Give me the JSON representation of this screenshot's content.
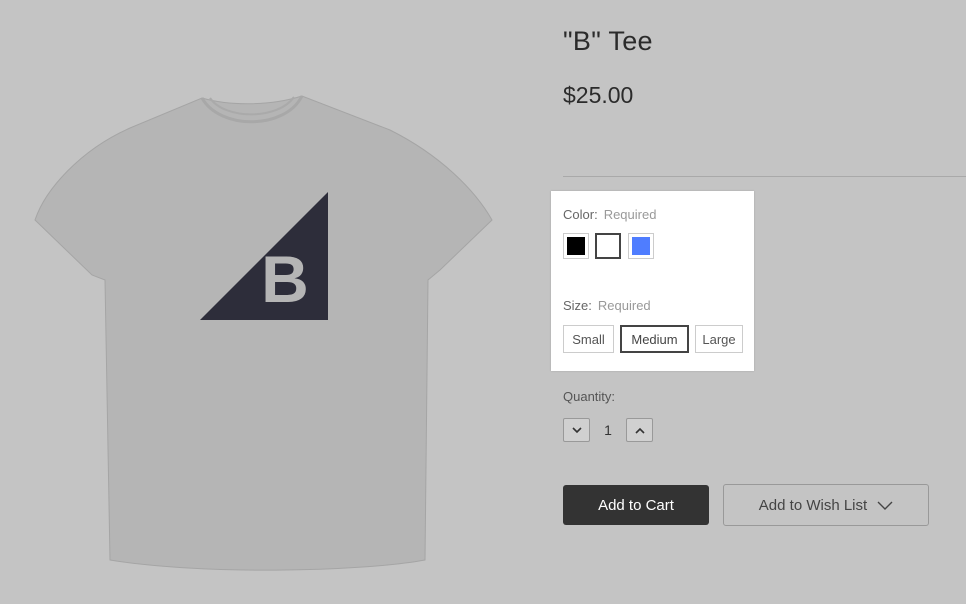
{
  "product": {
    "title": "\"B\" Tee",
    "price": "$25.00",
    "logo_letter": "B"
  },
  "options": {
    "color": {
      "label": "Color:",
      "required": "Required",
      "swatches": [
        {
          "name": "black",
          "hex": "#000000"
        },
        {
          "name": "white",
          "hex": "#ffffff",
          "selected": true
        },
        {
          "name": "blue",
          "hex": "#4f7dff"
        }
      ]
    },
    "size": {
      "label": "Size:",
      "required": "Required",
      "choices": [
        "Small",
        "Medium",
        "Large"
      ],
      "selected": "Medium"
    }
  },
  "quantity": {
    "label": "Quantity:",
    "value": "1"
  },
  "actions": {
    "add_to_cart": "Add to Cart",
    "wishlist": "Add to Wish List"
  },
  "colors": {
    "background": "#c4c4c4",
    "button_dark": "#333333",
    "shirt": "#b5b5b5",
    "logo": "#2d2d3a"
  }
}
